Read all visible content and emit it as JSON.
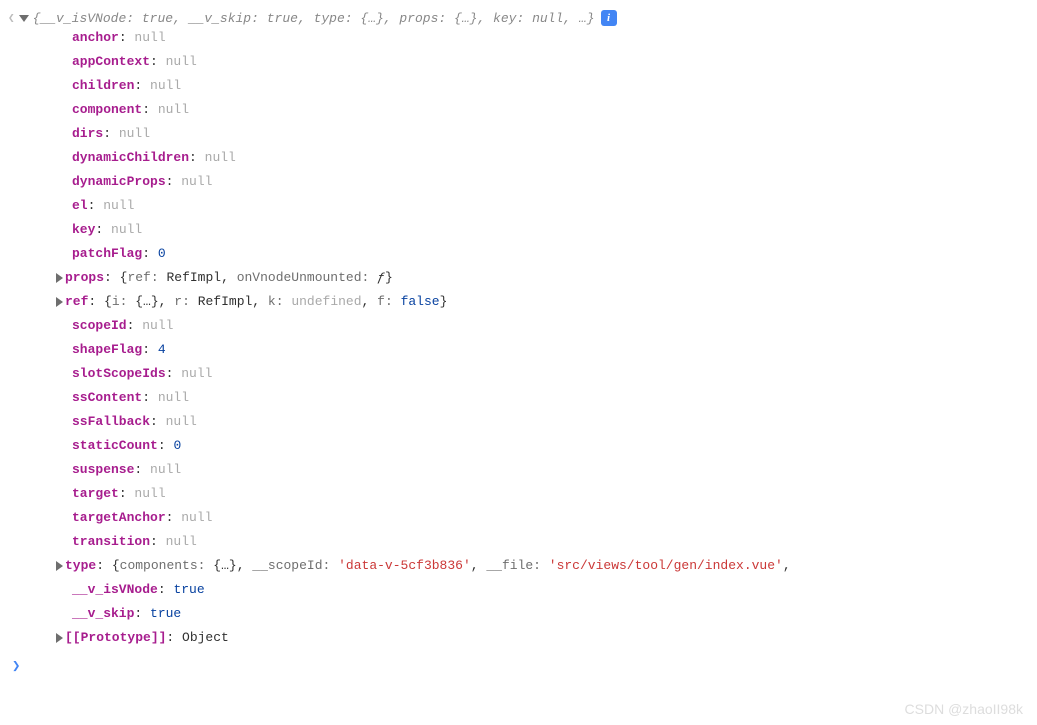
{
  "root": {
    "summary_parts": [
      {
        "k": "__v_isVNode",
        "v": "true"
      },
      {
        "k": "__v_skip",
        "v": "true"
      },
      {
        "k": "type",
        "v": "{…}"
      },
      {
        "k": "props",
        "v": "{…}"
      },
      {
        "k": "key",
        "v": "null"
      }
    ],
    "ellipsis": "…"
  },
  "properties": [
    {
      "key": "anchor",
      "value": "null",
      "type": "null",
      "expandable": false
    },
    {
      "key": "appContext",
      "value": "null",
      "type": "null",
      "expandable": false
    },
    {
      "key": "children",
      "value": "null",
      "type": "null",
      "expandable": false
    },
    {
      "key": "component",
      "value": "null",
      "type": "null",
      "expandable": false
    },
    {
      "key": "dirs",
      "value": "null",
      "type": "null",
      "expandable": false
    },
    {
      "key": "dynamicChildren",
      "value": "null",
      "type": "null",
      "expandable": false
    },
    {
      "key": "dynamicProps",
      "value": "null",
      "type": "null",
      "expandable": false
    },
    {
      "key": "el",
      "value": "null",
      "type": "null",
      "expandable": false
    },
    {
      "key": "key",
      "value": "null",
      "type": "null",
      "expandable": false
    },
    {
      "key": "patchFlag",
      "value": "0",
      "type": "num",
      "expandable": false
    },
    {
      "key": "props",
      "value_raw": "{ref: RefImpl, onVnodeUnmounted: ƒ}",
      "type": "obj",
      "expandable": true,
      "inner": [
        {
          "k": "ref",
          "v": "RefImpl",
          "t": "plain"
        },
        {
          "k": "onVnodeUnmounted",
          "v": "ƒ",
          "t": "fn"
        }
      ]
    },
    {
      "key": "ref",
      "value_raw": "{i: {…}, r: RefImpl, k: undefined, f: false}",
      "type": "obj",
      "expandable": true,
      "inner": [
        {
          "k": "i",
          "v": "{…}",
          "t": "plain"
        },
        {
          "k": "r",
          "v": "RefImpl",
          "t": "plain"
        },
        {
          "k": "k",
          "v": "undefined",
          "t": "undef"
        },
        {
          "k": "f",
          "v": "false",
          "t": "bool"
        }
      ]
    },
    {
      "key": "scopeId",
      "value": "null",
      "type": "null",
      "expandable": false
    },
    {
      "key": "shapeFlag",
      "value": "4",
      "type": "num",
      "expandable": false
    },
    {
      "key": "slotScopeIds",
      "value": "null",
      "type": "null",
      "expandable": false
    },
    {
      "key": "ssContent",
      "value": "null",
      "type": "null",
      "expandable": false
    },
    {
      "key": "ssFallback",
      "value": "null",
      "type": "null",
      "expandable": false
    },
    {
      "key": "staticCount",
      "value": "0",
      "type": "num",
      "expandable": false
    },
    {
      "key": "suspense",
      "value": "null",
      "type": "null",
      "expandable": false
    },
    {
      "key": "target",
      "value": "null",
      "type": "null",
      "expandable": false
    },
    {
      "key": "targetAnchor",
      "value": "null",
      "type": "null",
      "expandable": false
    },
    {
      "key": "transition",
      "value": "null",
      "type": "null",
      "expandable": false
    },
    {
      "key": "type",
      "value_raw": "{components: {…}, __scopeId: 'data-v-5cf3b836', __file: 'src/views/tool/gen/index.vue',",
      "type": "obj",
      "expandable": true,
      "inner": [
        {
          "k": "components",
          "v": "{…}",
          "t": "plain"
        },
        {
          "k": "__scopeId",
          "v": "'data-v-5cf3b836'",
          "t": "str"
        },
        {
          "k": "__file",
          "v": "'src/views/tool/gen/index.vue'",
          "t": "str"
        }
      ],
      "trailing": ","
    },
    {
      "key": "__v_isVNode",
      "value": "true",
      "type": "bool",
      "expandable": false
    },
    {
      "key": "__v_skip",
      "value": "true",
      "type": "bool",
      "expandable": false
    },
    {
      "key": "[[Prototype]]",
      "value": "Object",
      "type": "plain",
      "expandable": true
    }
  ],
  "prompt": "❯",
  "watermark": "CSDN @zhaoII98k"
}
